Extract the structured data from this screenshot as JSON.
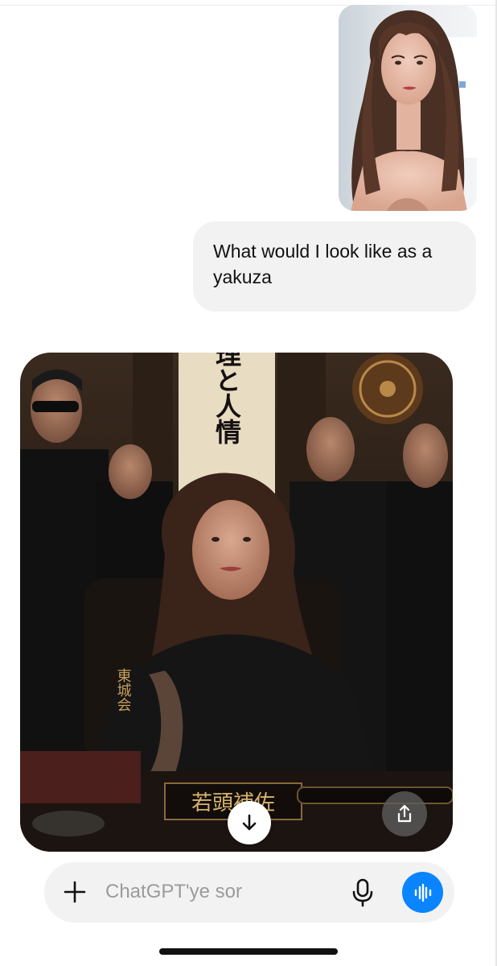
{
  "conversation": {
    "user_message": "What would I look like as a yakuza",
    "user_photo_icon": "selfie-photo",
    "generated_image": {
      "scroll_roll_text": "義理と人情",
      "jacket_text": "東城会",
      "nameplate_text": "若頭補佐"
    }
  },
  "image_actions": {
    "download_icon": "arrow-down-icon",
    "share_icon": "share-icon"
  },
  "composer": {
    "placeholder": "ChatGPT'ye sor",
    "plus_icon": "plus-icon",
    "mic_icon": "microphone-icon",
    "voice_icon": "voice-mode-icon",
    "voice_color": "#0a84ff"
  }
}
